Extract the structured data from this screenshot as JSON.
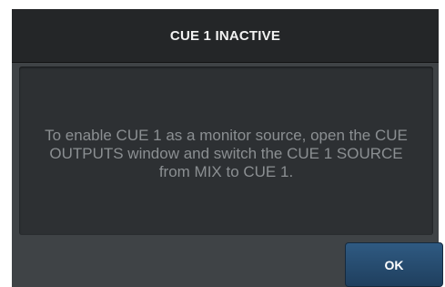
{
  "dialog": {
    "title": "CUE 1 INACTIVE",
    "message": "To enable CUE 1 as a monitor source, open the CUE OUTPUTS window and switch the CUE 1 SOURCE from MIX to CUE 1.",
    "ok_label": "OK"
  },
  "colors": {
    "titlebar": "#242628",
    "panel": "#2d3033",
    "dialog_bg": "#3f4346",
    "button": "#2a4f73"
  }
}
